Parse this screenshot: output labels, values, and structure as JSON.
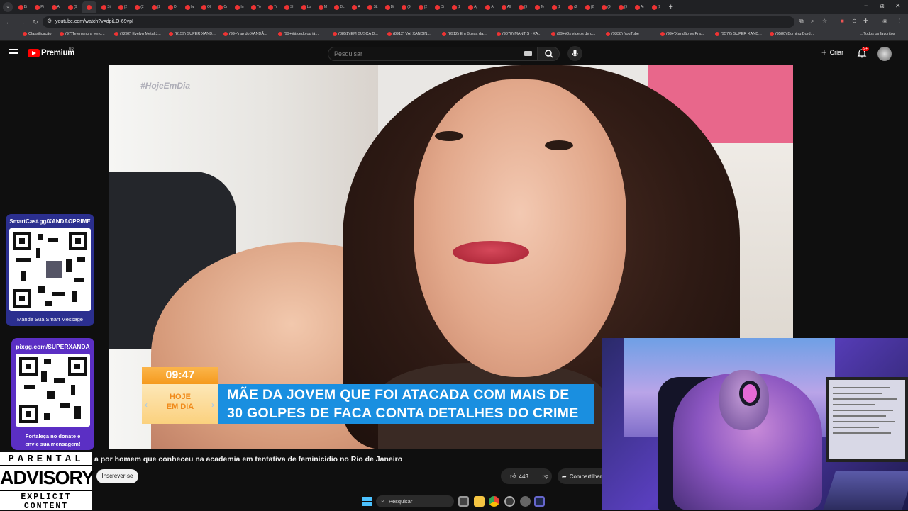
{
  "browser": {
    "tabs": [
      "Bi",
      "Pi",
      "Ar",
      "(9",
      "",
      "Si",
      "(2",
      "(2",
      "(2",
      "Di",
      "Iw",
      "Ol",
      "Cr",
      "In",
      "Yo",
      "Tr",
      "Sh",
      "Lo",
      "M",
      "Dc",
      "A",
      "SL",
      "Di",
      "(9",
      "(2",
      "Di",
      "(2",
      "Aj",
      "A",
      "All",
      "(9",
      "Te",
      "(2",
      "(2",
      "(2",
      "(9",
      "(9",
      "Ar",
      "(9"
    ],
    "new_tab": "+",
    "window_controls": [
      "−",
      "⧉",
      "✕"
    ],
    "url": "youtube.com/watch?v=dpiLO-69vpI",
    "bookmarks": [
      "Classificação",
      "(97)Te ensino a venc...",
      "(7292) Evelyn Metal J...",
      "(8159) SUPER XAND...",
      "(99+)rap do XANDÃ...",
      "(99+)tá cedo ou já...",
      "(8851) EM BUSCA D...",
      "(8912) VAI XANDIN...",
      "(8912) Em Busca da...",
      "(9078) MANTIS - XA...",
      "(99+)Os vídeos de c...",
      "(9338) YouTube",
      "(99+)Xandão vs Fra...",
      "(9572) SUPER XAND...",
      "(9580) Burning Bord..."
    ],
    "all_bookmarks": "Todos os favoritos"
  },
  "youtube": {
    "logo_text": "Premium",
    "logo_region": "BR",
    "search_placeholder": "Pesquisar",
    "create_label": "Criar",
    "notification_count": "9+",
    "video_title": "a por homem que conheceu na academia em tentativa de feminicídio no Rio de Janeiro",
    "subscribe_label": "Inscrever-se",
    "like_count": "443",
    "share_label": "Compartilhar"
  },
  "video_overlay": {
    "watermark": "#HojeEmDia",
    "time": "09:47",
    "logo_line1": "HOJE",
    "logo_line2": "EM DIA",
    "headline_line1": "MÃE DA JOVEM QUE FOI ATACADA COM MAIS DE",
    "headline_line2": "30 GOLPES DE FACA CONTA DETALHES DO CRIME"
  },
  "overlays": {
    "smartcast_url": "SmartCast.gg/XANDAOPRIME",
    "smartcast_caption": "Mande Sua Smart Message",
    "pixgg_url": "pixgg.com/SUPERXANDA",
    "pixgg_caption_1": "Fortaleça no donate e",
    "pixgg_caption_2": "envie sua mensagem!",
    "advisory_1": "PARENTAL",
    "advisory_2": "ADVISORY",
    "advisory_3": "EXPLICIT CONTENT"
  },
  "taskbar": {
    "search_placeholder": "Pesquisar"
  },
  "colors": {
    "youtube_red": "#ff0000",
    "news_blue": "#1a8fe0",
    "news_orange": "#f59a1e",
    "qr_card": "#2b2f8f"
  }
}
